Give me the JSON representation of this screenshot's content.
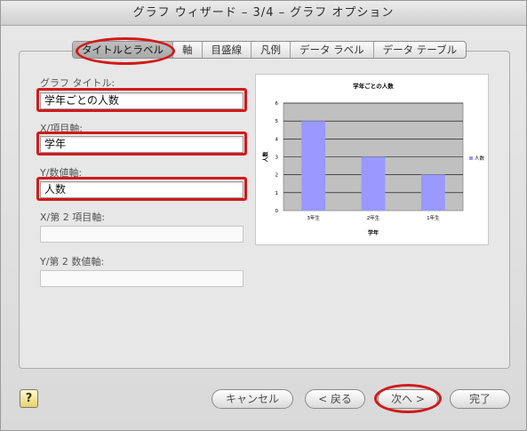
{
  "window": {
    "title": "グラフ ウィザード – 3/4 – グラフ オプション"
  },
  "tabs": [
    {
      "label": "タイトルとラベル",
      "active": true
    },
    {
      "label": "軸"
    },
    {
      "label": "目盛線"
    },
    {
      "label": "凡例"
    },
    {
      "label": "データ ラベル"
    },
    {
      "label": "データ テーブル"
    }
  ],
  "fields": {
    "chart_title": {
      "label": "グラフ タイトル:",
      "value": "学年ごとの人数"
    },
    "x_axis": {
      "label": "X/項目軸:",
      "value": "学年"
    },
    "y_axis": {
      "label": "Y/数値軸:",
      "value": "人数"
    },
    "x2_axis": {
      "label": "X/第 2 項目軸:",
      "value": ""
    },
    "y2_axis": {
      "label": "Y/第 2 数値軸:",
      "value": ""
    }
  },
  "chart_data": {
    "type": "bar",
    "title": "学年ごとの人数",
    "xlabel": "学年",
    "ylabel": "人数",
    "categories": [
      "3年生",
      "2年生",
      "1年生"
    ],
    "series": [
      {
        "name": "人数",
        "values": [
          5,
          3,
          2
        ]
      }
    ],
    "ylim": [
      0,
      6
    ],
    "yticks": [
      "0",
      "1",
      "2",
      "3",
      "4",
      "5",
      "6"
    ],
    "grid": true,
    "legend": "right",
    "bar_color": "#9999ff",
    "plot_bg": "#c0c0c0"
  },
  "buttons": {
    "help": "?",
    "cancel": "キャンセル",
    "back": "< 戻る",
    "next": "次へ >",
    "finish": "完了"
  },
  "colors": {
    "highlight": "#d11a1a"
  }
}
